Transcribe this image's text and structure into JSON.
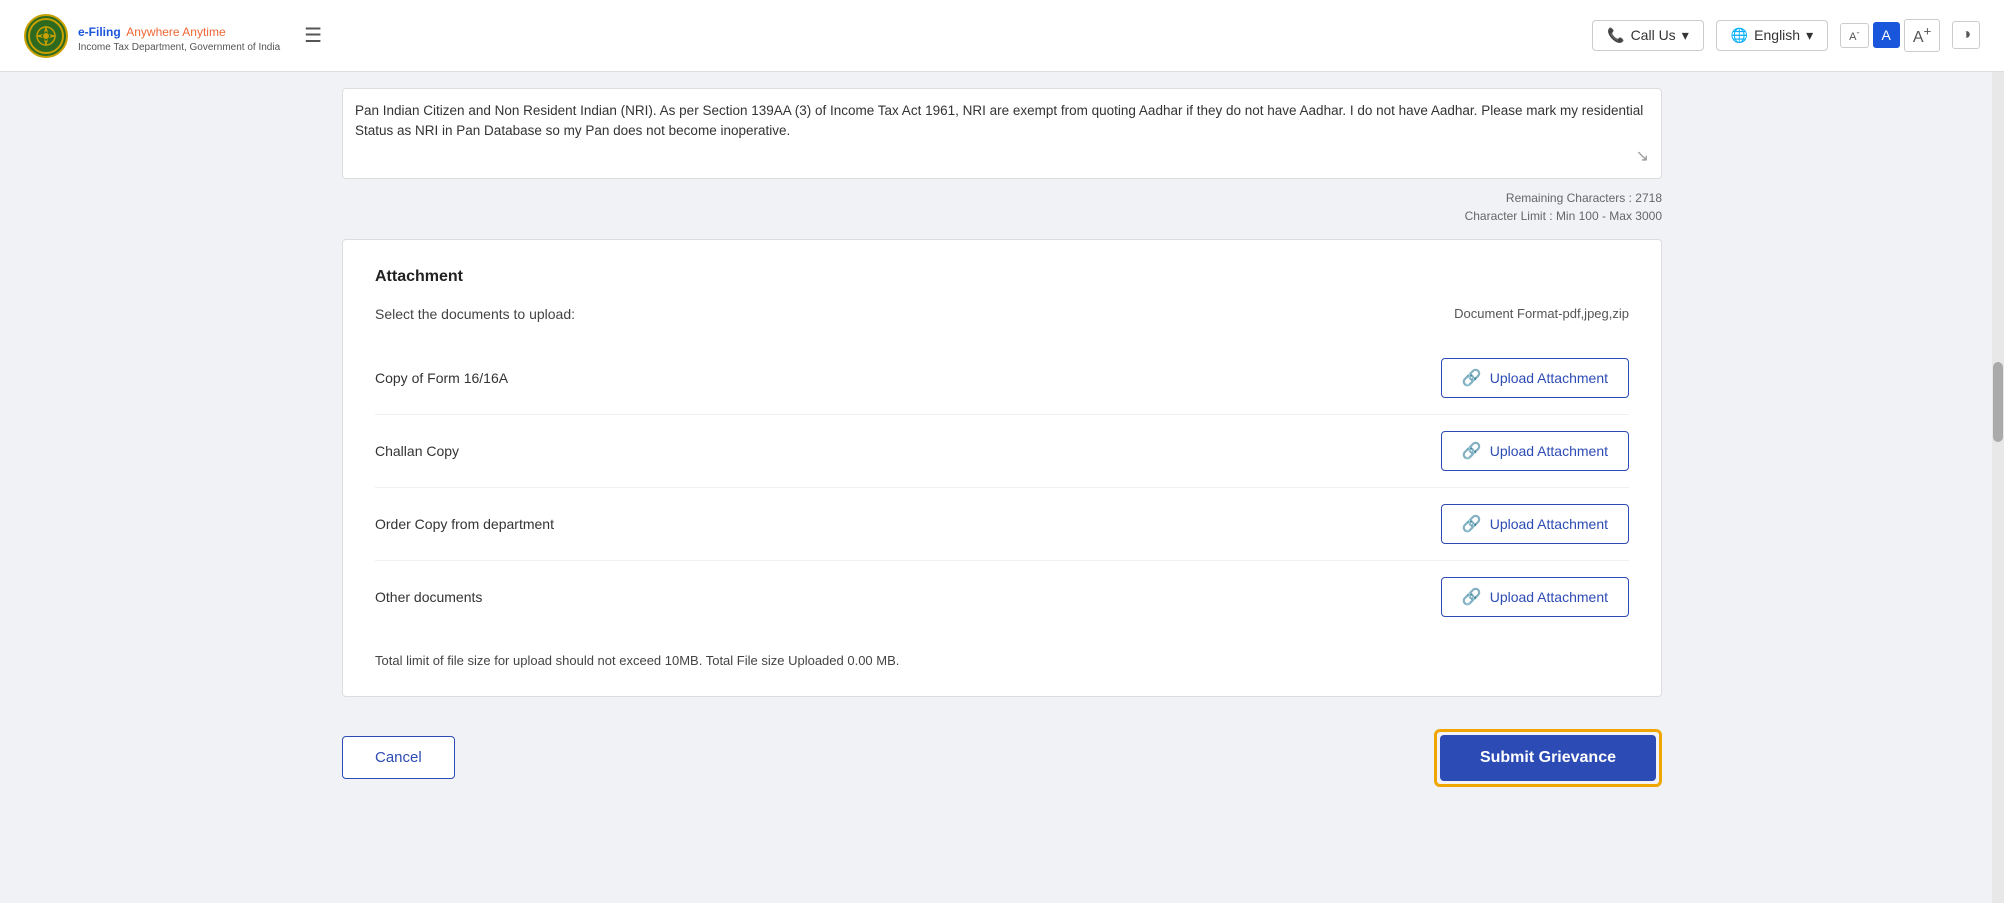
{
  "header": {
    "logo_title": "e-Filing",
    "logo_tagline": "Anywhere Anytime",
    "logo_subtitle": "Income Tax Department, Government of India",
    "call_us_label": "Call Us",
    "language_label": "English",
    "font_smaller_label": "A",
    "font_normal_label": "A",
    "font_larger_label": "A",
    "contrast_label": "◑"
  },
  "text_section": {
    "content": "Pan Indian Citizen and Non Resident Indian (NRI). As per Section 139AA (3) of Income Tax Act 1961, NRI are exempt from quoting Aadhar if they do not have Aadhar. I do not have Aadhar.  Please mark my residential Status as NRI in Pan Database so my Pan does not become inoperative."
  },
  "chars_info": {
    "remaining_label": "Remaining Characters : 2718",
    "limit_label": "Character Limit : Min 100 - Max 3000"
  },
  "attachment": {
    "title": "Attachment",
    "select_label": "Select the documents to upload:",
    "format_label": "Document Format-pdf,jpeg,zip",
    "documents": [
      {
        "id": "form16",
        "name": "Copy of Form 16/16A",
        "button_label": "Upload Attachment"
      },
      {
        "id": "challan",
        "name": "Challan Copy",
        "button_label": "Upload Attachment"
      },
      {
        "id": "order_copy",
        "name": "Order Copy from department",
        "button_label": "Upload Attachment"
      },
      {
        "id": "other",
        "name": "Other documents",
        "button_label": "Upload Attachment"
      }
    ],
    "file_limit_info": "Total limit of file size for upload should not exceed 10MB. Total File size Uploaded 0.00 MB."
  },
  "bottom_bar": {
    "cancel_label": "Cancel",
    "submit_label": "Submit Grievance"
  },
  "icons": {
    "hamburger": "☰",
    "phone": "📞",
    "globe": "🌐",
    "chevron_down": "▾",
    "upload": "🔗"
  }
}
